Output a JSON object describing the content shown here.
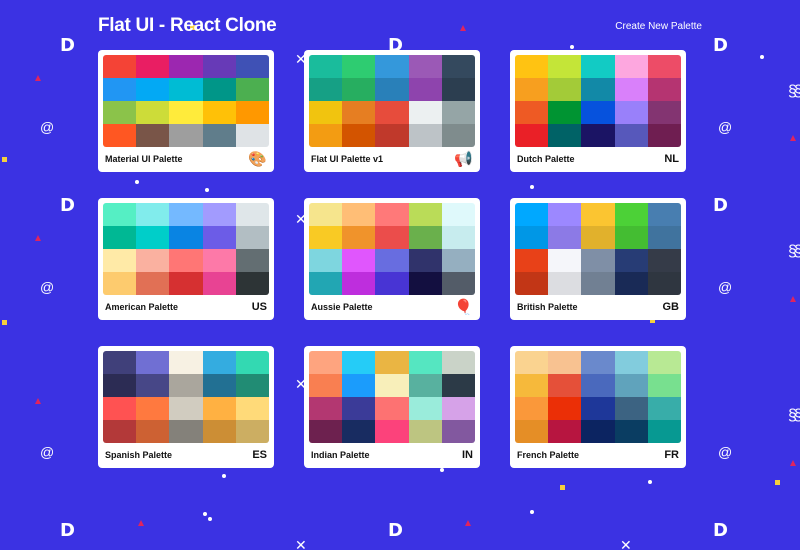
{
  "header": {
    "title": "Flat UI - React Clone",
    "new_palette_label": "Create New Palette"
  },
  "decor": {
    "d_glyph": "D",
    "x_glyph": "✕",
    "spiral_glyph": "@",
    "squiggle_glyph": "§§"
  },
  "palettes": [
    {
      "name": "Material UI Palette",
      "emoji": "🎨",
      "emoji_icon": "palette-icon",
      "colors": [
        "#f44336",
        "#e91e63",
        "#9c27b0",
        "#673ab7",
        "#3f51b5",
        "#2196f3",
        "#03a9f4",
        "#00bcd4",
        "#009688",
        "#4caf50",
        "#8bc34a",
        "#cddc39",
        "#ffeb3b",
        "#ffc107",
        "#ff9800",
        "#ff5722",
        "#795548",
        "#9e9e9e",
        "#607d8b",
        "#dfe3e6"
      ]
    },
    {
      "name": "Flat UI Palette v1",
      "emoji": "📢",
      "emoji_icon": "megaphone-icon",
      "colors": [
        "#1abc9c",
        "#2ecc71",
        "#3498db",
        "#9b59b6",
        "#34495e",
        "#16a085",
        "#27ae60",
        "#2980b9",
        "#8e44ad",
        "#2c3e50",
        "#f1c40f",
        "#e67e22",
        "#e74c3c",
        "#ecf0f1",
        "#95a5a6",
        "#f39c12",
        "#d35400",
        "#c0392b",
        "#bdc3c7",
        "#7f8c8d"
      ]
    },
    {
      "name": "Dutch Palette",
      "emoji": "NL",
      "emoji_icon": "",
      "colors": [
        "#ffc312",
        "#c4e538",
        "#12cbc4",
        "#fda7df",
        "#ed4c67",
        "#f79f1f",
        "#a3cb38",
        "#1289a7",
        "#d980fa",
        "#b53471",
        "#ee5a24",
        "#009432",
        "#0652dd",
        "#9980fa",
        "#833471",
        "#ea2027",
        "#006266",
        "#1b1464",
        "#5758bb",
        "#6f1e51"
      ]
    },
    {
      "name": "American Palette",
      "emoji": "US",
      "emoji_icon": "",
      "colors": [
        "#55efc4",
        "#81ecec",
        "#74b9ff",
        "#a29bfe",
        "#dfe6e9",
        "#00b894",
        "#00cec9",
        "#0984e3",
        "#6c5ce7",
        "#b2bec3",
        "#ffeaa7",
        "#fab1a0",
        "#ff7675",
        "#fd79a8",
        "#636e72",
        "#fdcb6e",
        "#e17055",
        "#d63031",
        "#e84393",
        "#2d3436"
      ]
    },
    {
      "name": "Aussie Palette",
      "emoji": "🎈",
      "emoji_icon": "balloon-icon",
      "colors": [
        "#f6e58d",
        "#ffbe76",
        "#ff7979",
        "#badc58",
        "#dff9fb",
        "#f9ca24",
        "#f0932b",
        "#eb4d4b",
        "#6ab04c",
        "#c7ecee",
        "#7ed6df",
        "#e056fd",
        "#686de0",
        "#30336b",
        "#95afc0",
        "#22a6b3",
        "#be2edd",
        "#4834d4",
        "#130f40",
        "#535c68"
      ]
    },
    {
      "name": "British Palette",
      "emoji": "GB",
      "emoji_icon": "",
      "colors": [
        "#00a8ff",
        "#9c88ff",
        "#fbc531",
        "#4cd137",
        "#487eb0",
        "#0097e6",
        "#8c7ae6",
        "#e1b12c",
        "#44bd32",
        "#40739e",
        "#e84118",
        "#f5f6fa",
        "#7f8fa6",
        "#273c75",
        "#353b48",
        "#c23616",
        "#dcdde1",
        "#718093",
        "#192a56",
        "#2f3640"
      ]
    },
    {
      "name": "Spanish Palette",
      "emoji": "ES",
      "emoji_icon": "",
      "colors": [
        "#40407a",
        "#706fd3",
        "#f7f1e3",
        "#34ace0",
        "#33d9b2",
        "#2c2c54",
        "#474787",
        "#aaa69d",
        "#227093",
        "#218c74",
        "#ff5252",
        "#ff793f",
        "#d1ccc0",
        "#ffb142",
        "#ffda79",
        "#b33939",
        "#cd6133",
        "#84817a",
        "#cc8e35",
        "#ccae62"
      ]
    },
    {
      "name": "Indian Palette",
      "emoji": "IN",
      "emoji_icon": "",
      "colors": [
        "#fea47f",
        "#25ccf7",
        "#eab543",
        "#55e6c1",
        "#cad3c8",
        "#f97f51",
        "#1b9cfc",
        "#f8efba",
        "#58b19f",
        "#2c3a47",
        "#b33771",
        "#3b3b98",
        "#fd7272",
        "#9aecdb",
        "#d6a2e8",
        "#6d214f",
        "#182c61",
        "#fc427b",
        "#bdc581",
        "#82589f"
      ]
    },
    {
      "name": "French Palette",
      "emoji": "FR",
      "emoji_icon": "",
      "colors": [
        "#fad390",
        "#f8c291",
        "#6a89cc",
        "#82ccdd",
        "#b8e994",
        "#f6b93b",
        "#e55039",
        "#4a69bd",
        "#60a3bc",
        "#78e08f",
        "#fa983a",
        "#eb2f06",
        "#1e3799",
        "#3c6382",
        "#38ada9",
        "#e58e26",
        "#b71540",
        "#0c2461",
        "#0a3d62",
        "#079992"
      ]
    }
  ]
}
